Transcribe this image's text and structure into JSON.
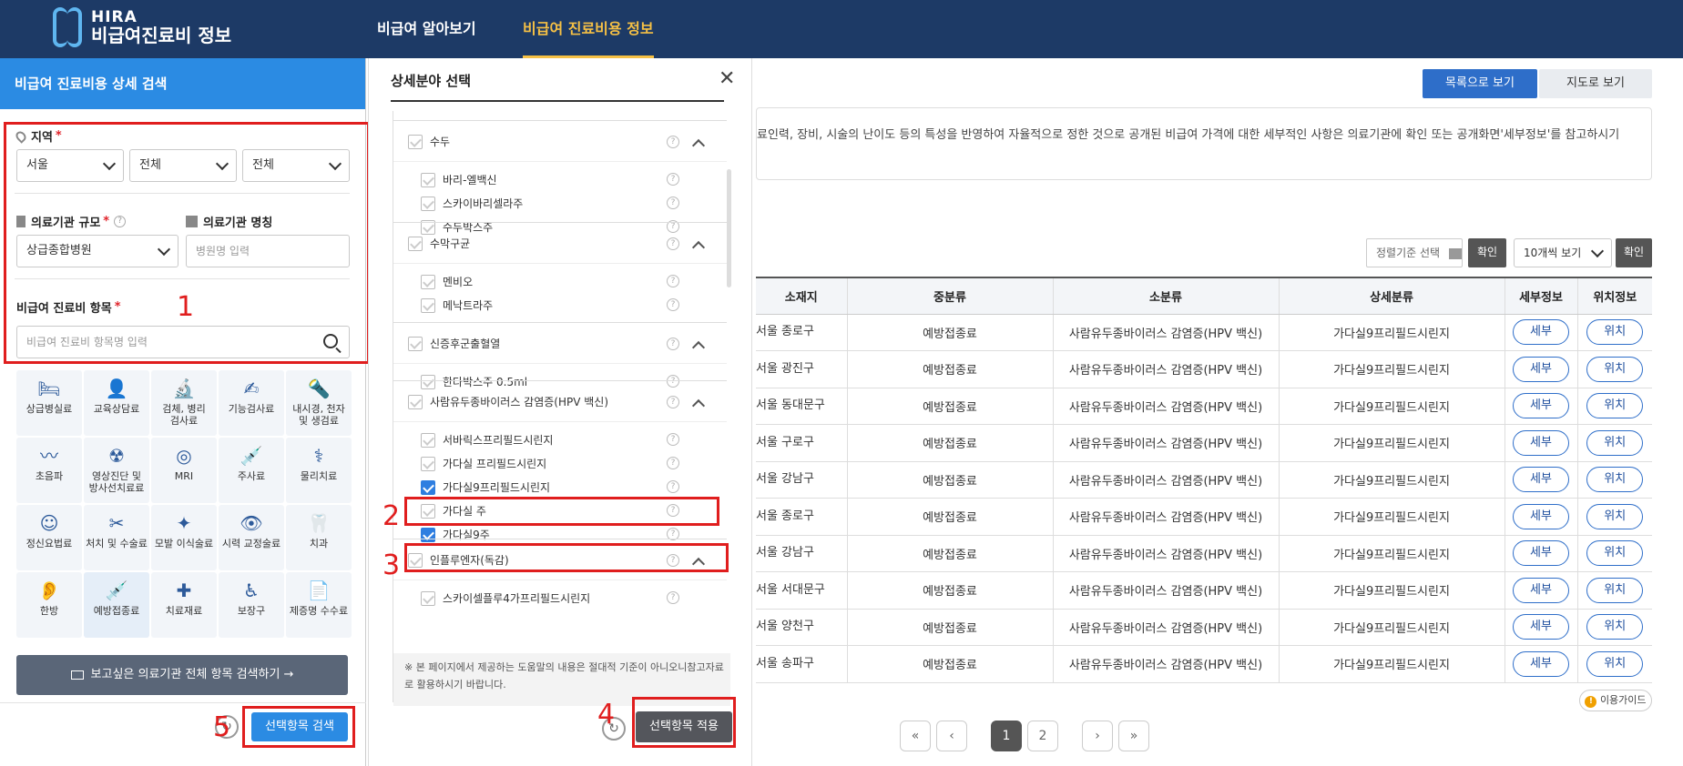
{
  "header": {
    "brand_en": "HIRA",
    "brand_ko": "비급여진료비 정보",
    "nav": [
      "비급여 알아보기",
      "비급여 진료비용 정보"
    ]
  },
  "left": {
    "title": "비급여 진료비용 상세 검색",
    "region_label": "지역",
    "region_values": [
      "서울",
      "전체",
      "전체"
    ],
    "scale_label": "의료기관 규모",
    "scale_value": "상급종합병원",
    "name_label": "의료기관 명칭",
    "name_placeholder": "병원명 입력",
    "item_label": "비급여 진료비 항목",
    "item_placeholder": "비급여 진료비 항목명 입력",
    "categories": [
      "상급병실료",
      "교육상담료",
      "검체, 병리\n검사료",
      "기능검사료",
      "내시경, 천자\n및 생검료",
      "초음파",
      "영상진단 및\n방사선치료료",
      "MRI",
      "주사료",
      "물리치료",
      "정신요법료",
      "처치 및 수술료",
      "모발 이식술료",
      "시력 교정술료",
      "치과",
      "한방",
      "예방접종료",
      "치료재료",
      "보장구",
      "제증명 수수료"
    ],
    "search_all_label": "보고싶은 의료기관 전체 항목 검색하기  →",
    "search_selected_label": "선택항목 검색",
    "annotations": [
      "1",
      "5"
    ]
  },
  "popup": {
    "title": "상세분야 선택",
    "groups": [
      {
        "name": "수두",
        "items": [
          "바리-엘백신",
          "스카이바리셀라주",
          "수두박스주"
        ]
      },
      {
        "name": "수막구균",
        "items": [
          "멘비오",
          "메낙트라주"
        ]
      },
      {
        "name": "신증후군출혈열",
        "items": [
          "한타박스주 0.5ml"
        ]
      },
      {
        "name": "사람유두종바이러스 감염증(HPV 백신)",
        "items": [
          "서바릭스프리필드시린지",
          "가다실 프리필드시린지",
          "가다실9프리필드시린지",
          "가다실 주",
          "가다실9주"
        ]
      },
      {
        "name": "인플루엔자(독감)",
        "items": [
          "스카이셀플루4가프리필드시린지"
        ]
      }
    ],
    "note": "※ 본 페이지에서 제공하는 도움말의 내용은 절대적 기준이 아니오니참고자료로 활용하시기 바랍니다.",
    "apply_label": "선택항목 적용",
    "annotations": [
      "2",
      "3",
      "4"
    ]
  },
  "right": {
    "view_list": "목록으로 보기",
    "view_map": "지도로 보기",
    "info_text": "료인력, 장비, 시술의 난이도 등의 특성을 반영하여 자율적으로 정한 것으로 공개된 비급여 가격에 대한 세부적인 사항은 의료기관에 확인 또는 공개화면'세부정보'를 참고하시기",
    "sort_label": "정렬기준 선택",
    "confirm": "확인",
    "per_page": "10개씩 보기",
    "columns": [
      "소재지",
      "중분류",
      "소분류",
      "상세분류",
      "세부정보",
      "위치정보"
    ],
    "rows": [
      [
        "서울 종로구",
        "예방접종료",
        "사람유두종바이러스 감염증(HPV 백신)",
        "가다실9프리필드시린지",
        "세부",
        "위치"
      ],
      [
        "서울 광진구",
        "예방접종료",
        "사람유두종바이러스 감염증(HPV 백신)",
        "가다실9프리필드시린지",
        "세부",
        "위치"
      ],
      [
        "서울 동대문구",
        "예방접종료",
        "사람유두종바이러스 감염증(HPV 백신)",
        "가다실9프리필드시린지",
        "세부",
        "위치"
      ],
      [
        "서울 구로구",
        "예방접종료",
        "사람유두종바이러스 감염증(HPV 백신)",
        "가다실9프리필드시린지",
        "세부",
        "위치"
      ],
      [
        "서울 강남구",
        "예방접종료",
        "사람유두종바이러스 감염증(HPV 백신)",
        "가다실9프리필드시린지",
        "세부",
        "위치"
      ],
      [
        "서울 종로구",
        "예방접종료",
        "사람유두종바이러스 감염증(HPV 백신)",
        "가다실9프리필드시린지",
        "세부",
        "위치"
      ],
      [
        "서울 강남구",
        "예방접종료",
        "사람유두종바이러스 감염증(HPV 백신)",
        "가다실9프리필드시린지",
        "세부",
        "위치"
      ],
      [
        "서울 서대문구",
        "예방접종료",
        "사람유두종바이러스 감염증(HPV 백신)",
        "가다실9프리필드시린지",
        "세부",
        "위치"
      ],
      [
        "서울 양천구",
        "예방접종료",
        "사람유두종바이러스 감염증(HPV 백신)",
        "가다실9프리필드시린지",
        "세부",
        "위치"
      ],
      [
        "서울 송파구",
        "예방접종료",
        "사람유두종바이러스 감염증(HPV 백신)",
        "가다실9프리필드시린지",
        "세부",
        "위치"
      ]
    ],
    "pages": [
      "1",
      "2"
    ],
    "guide": "이용가이드"
  },
  "colors": {
    "navy": "#1d3a66",
    "blue": "#2b8be3",
    "red": "#e01e1e",
    "gold": "#f5c045"
  }
}
